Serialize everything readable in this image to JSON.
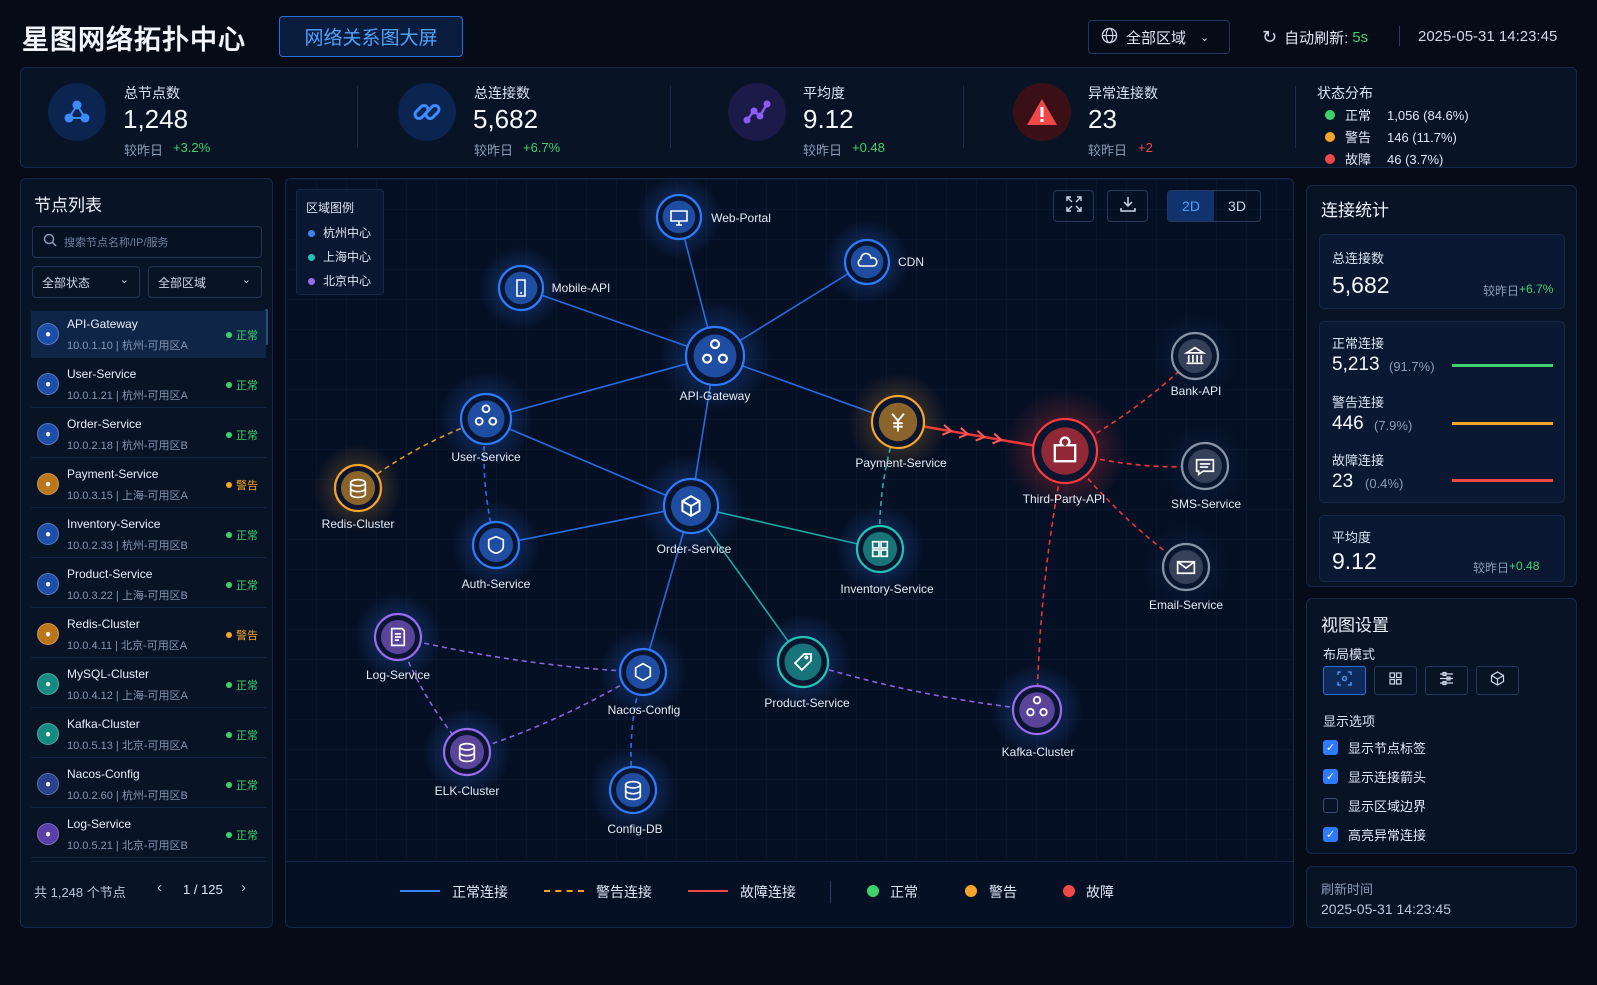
{
  "header": {
    "title": "星图网络拓扑中心",
    "subtitle_tab": "网络关系图大屏",
    "region_select": "全部区域",
    "auto_refresh_label": "自动刷新:",
    "auto_refresh_value": "5s",
    "datetime": "2025-05-31 14:23:45"
  },
  "kpis": [
    {
      "label": "总节点数",
      "value": "1,248",
      "cmp": "较昨日",
      "delta": "+3.2%"
    },
    {
      "label": "总连接数",
      "value": "5,682",
      "cmp": "较昨日",
      "delta": "+6.7%"
    },
    {
      "label": "平均度",
      "value": "9.12",
      "cmp": "较昨日",
      "delta": "+0.48"
    },
    {
      "label": "异常连接数",
      "value": "23",
      "cmp": "较昨日",
      "delta": "+2"
    }
  ],
  "status_dist": {
    "title": "状态分布",
    "items": [
      {
        "label": "正常",
        "value": "1,056 (84.6%)",
        "color": "#3fd16b"
      },
      {
        "label": "警告",
        "value": "146 (11.7%)",
        "color": "#f6a52a"
      },
      {
        "label": "故障",
        "value": "46 (3.7%)",
        "color": "#f04848"
      }
    ]
  },
  "node_list": {
    "title": "节点列表",
    "search_placeholder": "搜索节点名称/IP/服务",
    "filter_status": "全部状态",
    "filter_region": "全部区域",
    "items": [
      {
        "name": "API-Gateway",
        "ip": "10.0.1.10 | 杭州-可用区A",
        "status": "正常",
        "level": "ok"
      },
      {
        "name": "User-Service",
        "ip": "10.0.1.21 | 杭州-可用区A",
        "status": "正常",
        "level": "ok"
      },
      {
        "name": "Order-Service",
        "ip": "10.0.2.18 | 杭州-可用区B",
        "status": "正常",
        "level": "ok"
      },
      {
        "name": "Payment-Service",
        "ip": "10.0.3.15 | 上海-可用区A",
        "status": "警告",
        "level": "warn"
      },
      {
        "name": "Inventory-Service",
        "ip": "10.0.2.33 | 杭州-可用区B",
        "status": "正常",
        "level": "ok"
      },
      {
        "name": "Product-Service",
        "ip": "10.0.3.22 | 上海-可用区B",
        "status": "正常",
        "level": "ok"
      },
      {
        "name": "Redis-Cluster",
        "ip": "10.0.4.11 | 北京-可用区A",
        "status": "警告",
        "level": "warn"
      },
      {
        "name": "MySQL-Cluster",
        "ip": "10.0.4.12 | 上海-可用区A",
        "status": "正常",
        "level": "ok"
      },
      {
        "name": "Kafka-Cluster",
        "ip": "10.0.5.13 | 北京-可用区A",
        "status": "正常",
        "level": "ok"
      },
      {
        "name": "Nacos-Config",
        "ip": "10.0.2.60 | 杭州-可用区B",
        "status": "正常",
        "level": "ok"
      },
      {
        "name": "Log-Service",
        "ip": "10.0.5.21 | 北京-可用区B",
        "status": "正常",
        "level": "ok"
      }
    ],
    "total": "共 1,248 个节点",
    "page": "1 / 125"
  },
  "graph": {
    "legend_title": "区域图例",
    "regions": [
      {
        "label": "杭州中心",
        "color": "#3b82f6"
      },
      {
        "label": "上海中心",
        "color": "#22c3b5"
      },
      {
        "label": "北京中心",
        "color": "#9b6bf2"
      }
    ],
    "view_2d": "2D",
    "view_3d": "3D",
    "nodes": [
      "Web-Portal",
      "CDN",
      "Mobile-API",
      "API-Gateway",
      "User-Service",
      "Payment-Service",
      "Third-Party-API",
      "Bank-API",
      "SMS-Service",
      "Email-Service",
      "Redis-Cluster",
      "Order-Service",
      "Auth-Service",
      "Inventory-Service",
      "Log-Service",
      "Nacos-Config",
      "Product-Service",
      "Kafka-Cluster",
      "ELK-Cluster",
      "Config-DB"
    ],
    "bottom_legend": [
      "正常连接",
      "警告连接",
      "故障连接",
      "正常",
      "警告",
      "故障"
    ]
  },
  "conn_stats": {
    "title": "连接统计",
    "total_label": "总连接数",
    "total_value": "5,682",
    "total_cmp": "较昨日",
    "total_delta": "+6.7%",
    "rows": [
      {
        "label": "正常连接",
        "value": "5,213",
        "pct": "(91.7%)",
        "color": "#3fd16b"
      },
      {
        "label": "警告连接",
        "value": "446",
        "pct": "(7.9%)",
        "color": "#f6a52a"
      },
      {
        "label": "故障连接",
        "value": "23",
        "pct": "(0.4%)",
        "color": "#f04848"
      }
    ],
    "avg_label": "平均度",
    "avg_value": "9.12",
    "avg_cmp": "较昨日",
    "avg_delta": "+0.48"
  },
  "view_settings": {
    "title": "视图设置",
    "layout_label": "布局模式",
    "display_label": "显示选项",
    "options": [
      {
        "label": "显示节点标签",
        "checked": true
      },
      {
        "label": "显示连接箭头",
        "checked": true
      },
      {
        "label": "显示区域边界",
        "checked": false
      },
      {
        "label": "高亮异常连接",
        "checked": true
      }
    ]
  },
  "refresh": {
    "label": "刷新时间",
    "value": "2025-05-31 14:23:45"
  }
}
